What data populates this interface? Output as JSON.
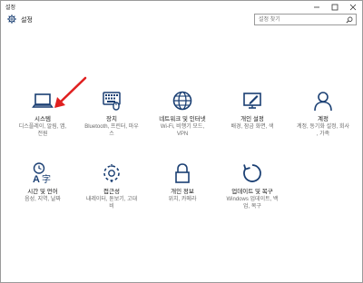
{
  "window": {
    "title": "설정",
    "minimize": "—",
    "maximize": "☐",
    "close": "✕"
  },
  "header": {
    "title": "설정",
    "search_placeholder": "설정 찾기"
  },
  "tiles": [
    {
      "name": "시스템",
      "desc1": "디스플레이, 알림, 앱,",
      "desc2": "전원",
      "icon": "laptop-icon"
    },
    {
      "name": "장치",
      "desc1": "Bluetooth, 프린터, 마우",
      "desc2": "스",
      "icon": "keyboard-icon"
    },
    {
      "name": "네트워크 및 인터넷",
      "desc1": "Wi-Fi, 비행기 모드,",
      "desc2": "VPN",
      "icon": "globe-icon"
    },
    {
      "name": "개인 설정",
      "desc1": "배경, 잠금 화면, 색",
      "desc2": "",
      "icon": "personalization-icon"
    },
    {
      "name": "계정",
      "desc1": "계정, 동기화 설정, 회사",
      "desc2": ", 가족",
      "icon": "person-icon"
    },
    {
      "name": "시간 및 언어",
      "desc1": "음성, 지역, 날짜",
      "desc2": "",
      "icon": "time-language-icon"
    },
    {
      "name": "접근성",
      "desc1": "내레이터, 돋보기, 고대",
      "desc2": "비",
      "icon": "ease-of-access-icon"
    },
    {
      "name": "개인 정보",
      "desc1": "위치, 카메라",
      "desc2": "",
      "icon": "lock-icon"
    },
    {
      "name": "업데이트 및 복구",
      "desc1": "Windows 업데이트, 백",
      "desc2": "업, 복구",
      "icon": "update-icon"
    }
  ],
  "colors": {
    "icon_blue": "#1a3f73",
    "arrow_red": "#e02020"
  }
}
